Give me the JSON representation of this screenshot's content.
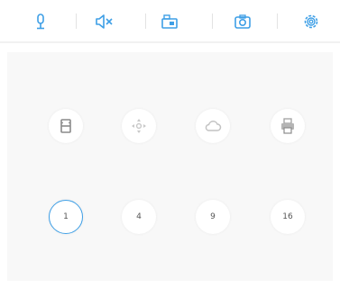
{
  "colors": {
    "accent": "#3e9fe6",
    "icon_gray": "#a9a9a9",
    "panel_bg": "#f8f8f8"
  },
  "toolbar": {
    "items": [
      {
        "name": "microphone-icon"
      },
      {
        "name": "speaker-mute-icon"
      },
      {
        "name": "video-record-icon"
      },
      {
        "name": "camera-icon"
      },
      {
        "name": "settings-icon"
      }
    ]
  },
  "controls": {
    "row1": [
      {
        "name": "film-icon"
      },
      {
        "name": "ptz-icon"
      },
      {
        "name": "cloud-icon"
      },
      {
        "name": "printer-icon"
      }
    ],
    "layouts": [
      {
        "label": "1",
        "selected": true
      },
      {
        "label": "4",
        "selected": false
      },
      {
        "label": "9",
        "selected": false
      },
      {
        "label": "16",
        "selected": false
      }
    ]
  }
}
